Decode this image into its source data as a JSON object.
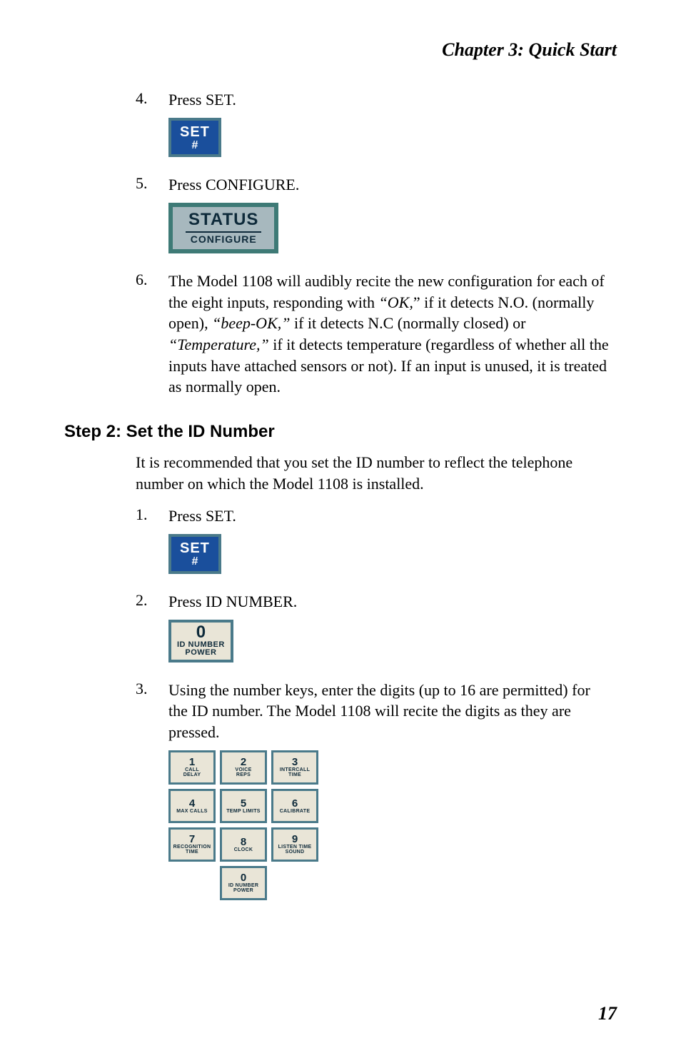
{
  "header": {
    "running_head": "Chapter 3:  Quick Start"
  },
  "section1": {
    "items": [
      {
        "num": "4.",
        "text": "Press SET.",
        "button": {
          "type": "set",
          "top": "SET",
          "bot": "#"
        }
      },
      {
        "num": "5.",
        "text": "Press CONFIGURE.",
        "button": {
          "type": "status",
          "top": "STATUS",
          "bot": "CONFIGURE"
        }
      },
      {
        "num": "6.",
        "text_pre": "The Model 1108 will audibly recite the new configuration for each of the eight inputs, responding with ",
        "quote1": "“OK,",
        "text_after_q1": "” if it detects N.O. (normally open), ",
        "quote2": "“beep-OK,”",
        "text_after_q2": " if it detects N.C (normally closed) or ",
        "quote3": "“Temperature,”",
        "text_after_q3": " if it detects temperature (regardless of whether all the inputs have attached sensors or not). If an input is unused, it is treated as normally open."
      }
    ]
  },
  "step2": {
    "heading": "Step 2:  Set the ID Number",
    "intro": "It is recommended that you set the ID number to reflect the telephone number on which the Model 1108 is installed.",
    "items": [
      {
        "num": "1.",
        "text": "Press SET.",
        "button": {
          "type": "set",
          "top": "SET",
          "bot": "#"
        }
      },
      {
        "num": "2.",
        "text": "Press ID NUMBER.",
        "button": {
          "type": "id",
          "top": "0",
          "mid": "ID NUMBER",
          "bot": "POWER"
        }
      },
      {
        "num": "3.",
        "text": "Using the number keys, enter the digits (up to 16 are permitted) for the ID number. The Model 1108 will recite the digits as they are pressed.",
        "keypad": [
          [
            {
              "digit": "1",
              "lbl": "CALL",
              "lbl2": "DELAY"
            },
            {
              "digit": "2",
              "lbl": "VOICE",
              "lbl2": "REPS"
            },
            {
              "digit": "3",
              "lbl": "INTERCALL",
              "lbl2": "TIME"
            }
          ],
          [
            {
              "digit": "4",
              "lbl": "MAX CALLS",
              "lbl2": ""
            },
            {
              "digit": "5",
              "lbl": "TEMP LIMITS",
              "lbl2": ""
            },
            {
              "digit": "6",
              "lbl": "CALIBRATE",
              "lbl2": ""
            }
          ],
          [
            {
              "digit": "7",
              "lbl": "RECOGNITION",
              "lbl2": "TIME"
            },
            {
              "digit": "8",
              "lbl": "CLOCK",
              "lbl2": ""
            },
            {
              "digit": "9",
              "lbl": "LISTEN TIME",
              "lbl2": "SOUND"
            }
          ],
          [
            {
              "digit": "0",
              "lbl": "ID NUMBER",
              "lbl2": "POWER"
            }
          ]
        ]
      }
    ]
  },
  "page_number": "17"
}
